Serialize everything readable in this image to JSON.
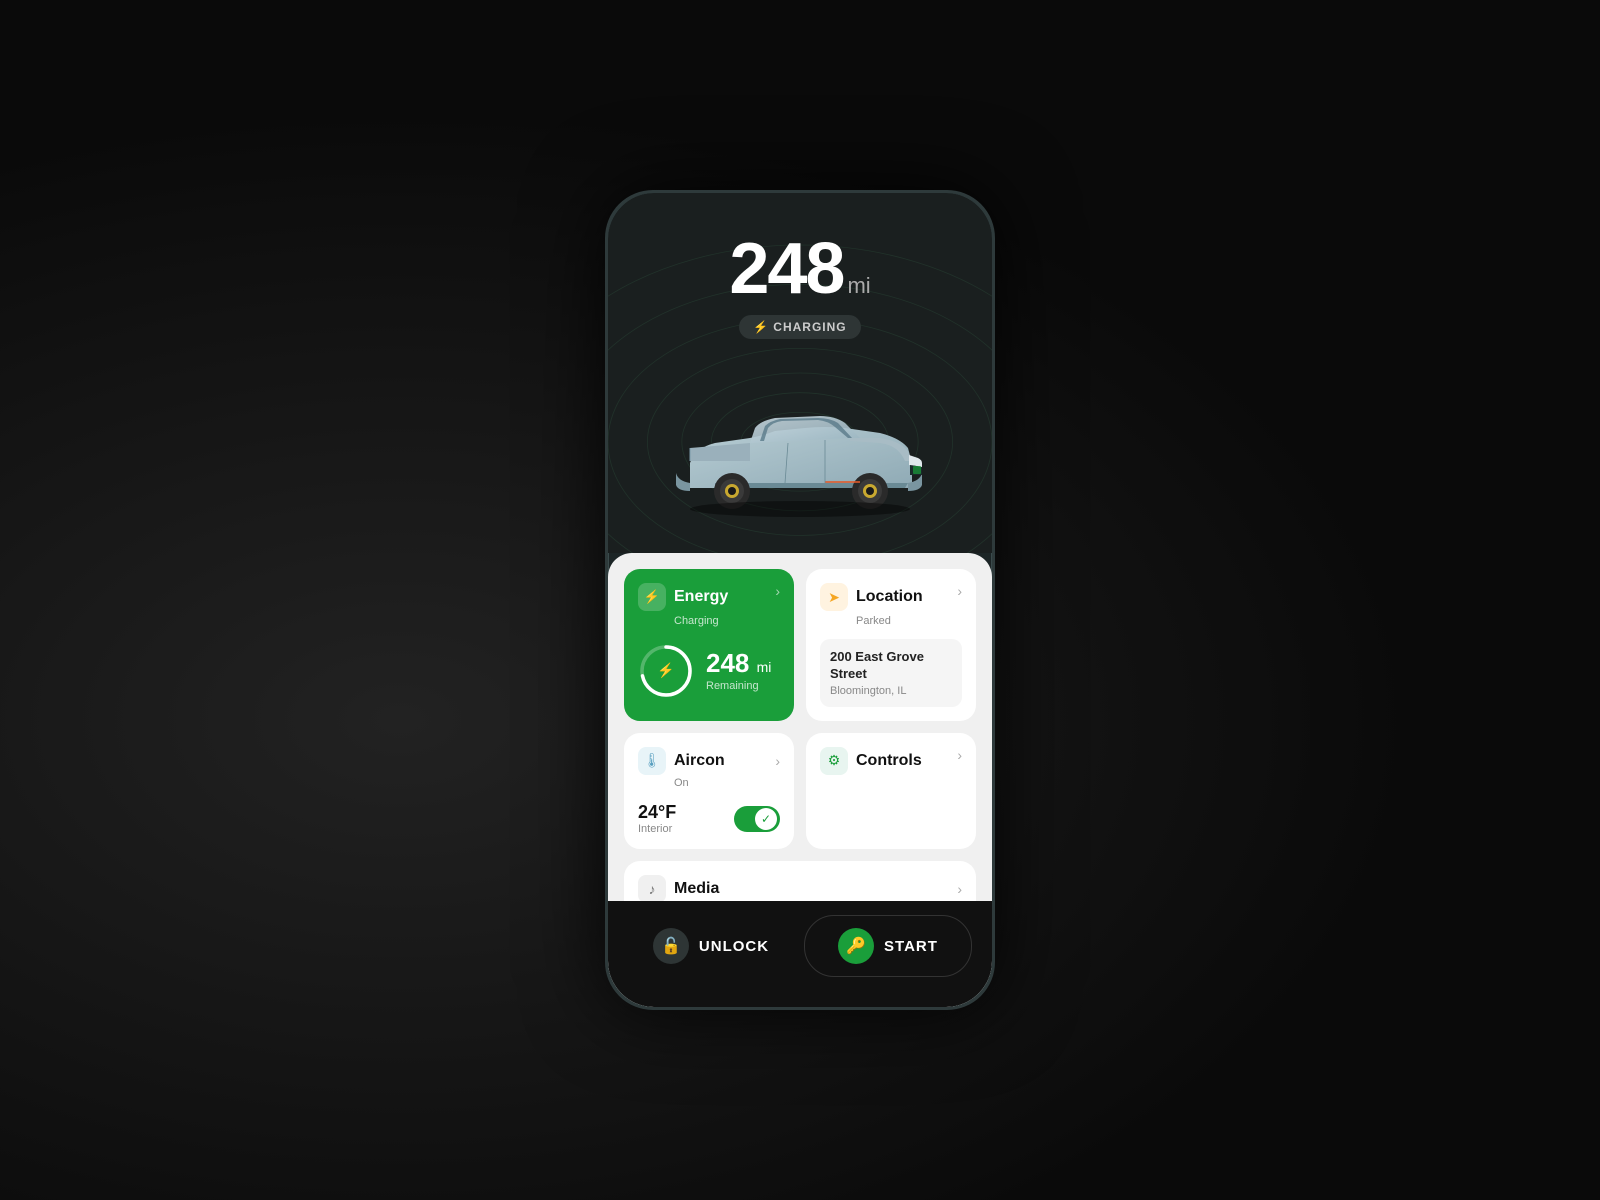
{
  "phone": {
    "mileage": "248",
    "mileage_unit": "mi",
    "charging_label": "CHARGING",
    "energy": {
      "title": "Energy",
      "subtitle": "Charging",
      "miles": "248 mi",
      "miles_number": "248",
      "miles_unit": "mi",
      "remaining_label": "Remaining",
      "progress_pct": 72
    },
    "location": {
      "title": "Location",
      "subtitle": "Parked",
      "address_line1": "200 East Grove",
      "address_line2": "Street",
      "address_city": "Bloomington, IL"
    },
    "aircon": {
      "title": "Aircon",
      "subtitle": "On",
      "temp": "24°F",
      "interior_label": "Interior"
    },
    "controls": {
      "title": "Controls"
    },
    "media": {
      "title": "Media"
    },
    "actions": {
      "unlock_label": "UNLOCK",
      "start_label": "START"
    }
  }
}
